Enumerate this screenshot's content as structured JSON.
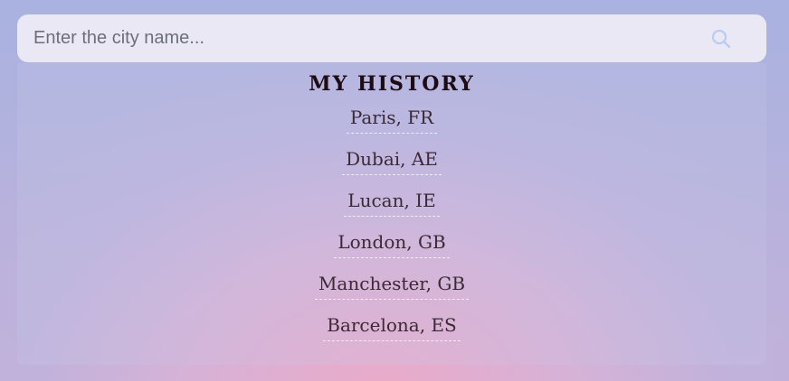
{
  "search": {
    "placeholder": "Enter the city name...",
    "value": "",
    "icon": "search-icon",
    "icon_color": "#b9cdf0"
  },
  "history": {
    "title": "MY HISTORY",
    "items": [
      "Paris, FR",
      "Dubai, AE",
      "Lucan, IE",
      "London, GB",
      "Manchester, GB",
      "Barcelona, ES"
    ]
  },
  "colors": {
    "title": "#1e0c12",
    "item_text": "#3b2a36",
    "gradient_pink": "#ecaac8",
    "gradient_blue": "#a9b2e0"
  }
}
